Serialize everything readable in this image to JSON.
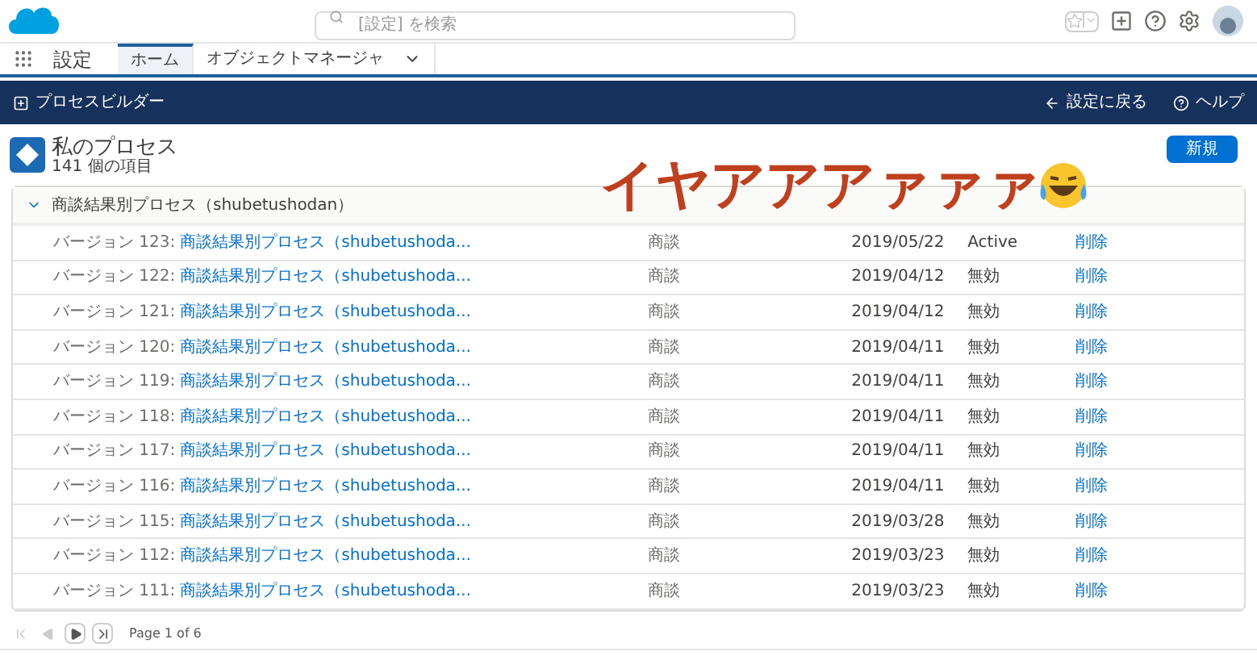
{
  "header": {
    "search": {
      "placeholder": "[設定] を検索"
    }
  },
  "app_bar": {
    "title": "設定",
    "tabs": [
      {
        "label": "ホーム",
        "selected": true,
        "menu": false
      },
      {
        "label": "オブジェクトマネージャ",
        "selected": false,
        "menu": true
      }
    ]
  },
  "builder_bar": {
    "title": "プロセスビルダー",
    "back": "設定に戻る",
    "help": "ヘルプ"
  },
  "page": {
    "title": "私のプロセス",
    "count": "141 個の項目",
    "new_button": "新規"
  },
  "overlay_caption": "イヤアアアァァァ",
  "group": {
    "label": "商談結果別プロセス（shubetushodan）",
    "expanded": true
  },
  "rows": [
    {
      "version": "バージョン 123:",
      "name": "商談結果別プロセス（shubetushoda...",
      "object": "商談",
      "date": "2019/05/22",
      "status": "Active",
      "action": "削除"
    },
    {
      "version": "バージョン 122:",
      "name": "商談結果別プロセス（shubetushoda...",
      "object": "商談",
      "date": "2019/04/12",
      "status": "無効",
      "action": "削除"
    },
    {
      "version": "バージョン 121:",
      "name": "商談結果別プロセス（shubetushoda...",
      "object": "商談",
      "date": "2019/04/12",
      "status": "無効",
      "action": "削除"
    },
    {
      "version": "バージョン 120:",
      "name": "商談結果別プロセス（shubetushoda...",
      "object": "商談",
      "date": "2019/04/11",
      "status": "無効",
      "action": "削除"
    },
    {
      "version": "バージョン 119:",
      "name": "商談結果別プロセス（shubetushoda...",
      "object": "商談",
      "date": "2019/04/11",
      "status": "無効",
      "action": "削除"
    },
    {
      "version": "バージョン 118:",
      "name": "商談結果別プロセス（shubetushoda...",
      "object": "商談",
      "date": "2019/04/11",
      "status": "無効",
      "action": "削除"
    },
    {
      "version": "バージョン 117:",
      "name": "商談結果別プロセス（shubetushoda...",
      "object": "商談",
      "date": "2019/04/11",
      "status": "無効",
      "action": "削除"
    },
    {
      "version": "バージョン 116:",
      "name": "商談結果別プロセス（shubetushoda...",
      "object": "商談",
      "date": "2019/04/11",
      "status": "無効",
      "action": "削除"
    },
    {
      "version": "バージョン 115:",
      "name": "商談結果別プロセス（shubetushoda...",
      "object": "商談",
      "date": "2019/03/28",
      "status": "無効",
      "action": "削除"
    },
    {
      "version": "バージョン 112:",
      "name": "商談結果別プロセス（shubetushoda...",
      "object": "商談",
      "date": "2019/03/23",
      "status": "無効",
      "action": "削除"
    },
    {
      "version": "バージョン 111:",
      "name": "商談結果別プロセス（shubetushoda...",
      "object": "商談",
      "date": "2019/03/23",
      "status": "無効",
      "action": "削除"
    }
  ],
  "pagination": {
    "buttons": [
      {
        "kind": "first",
        "disabled": true
      },
      {
        "kind": "prev",
        "disabled": true
      },
      {
        "kind": "next",
        "disabled": false
      },
      {
        "kind": "last",
        "disabled": false
      }
    ],
    "label": "Page 1 of 6"
  }
}
